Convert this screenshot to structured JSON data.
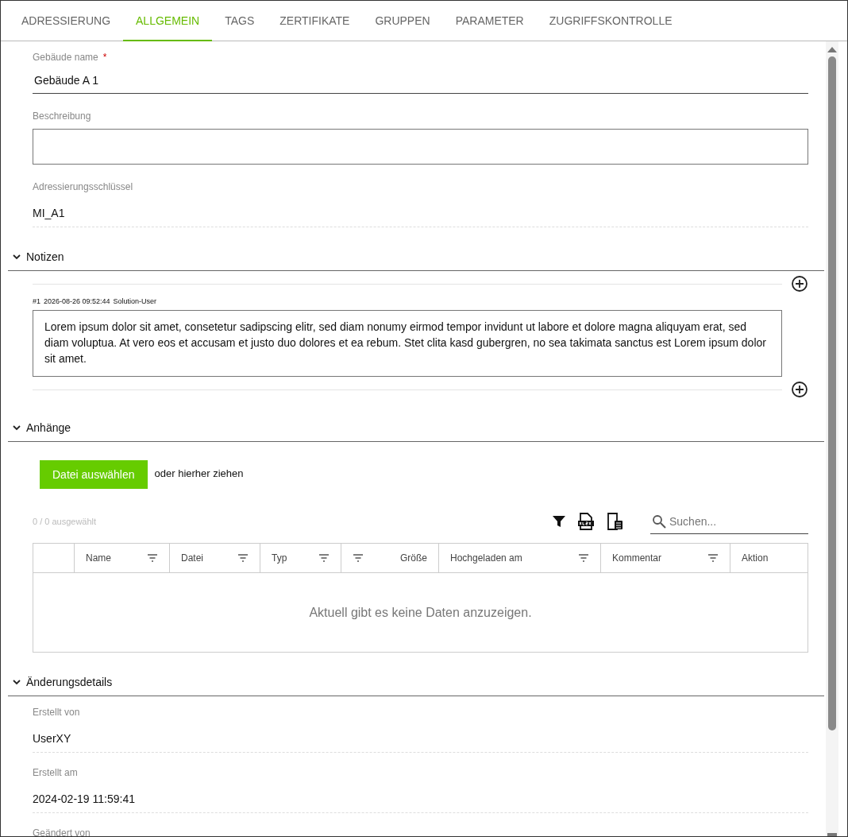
{
  "tabs": [
    {
      "label": "ADRESSIERUNG",
      "selected": false
    },
    {
      "label": "ALLGEMEIN",
      "selected": true
    },
    {
      "label": "TAGS",
      "selected": false
    },
    {
      "label": "ZERTIFIKATE",
      "selected": false
    },
    {
      "label": "GRUPPEN",
      "selected": false
    },
    {
      "label": "PARAMETER",
      "selected": false
    },
    {
      "label": "ZUGRIFFSKONTROLLE",
      "selected": false
    }
  ],
  "general_fields": [
    {
      "kind": "input",
      "label": "Gebäude name",
      "required_mark": "*",
      "value": "Gebäude A 1"
    },
    {
      "kind": "textarea",
      "label": "Beschreibung"
    },
    {
      "kind": "readonly",
      "label": "Adressierungsschlüssel",
      "value": "MI_A1"
    }
  ],
  "notes_section": {
    "title": "Notizen",
    "expanded": true,
    "notes": [
      {
        "number": "#1",
        "timestamp": "2026-08-26 09:52:44",
        "author": "Solution-User",
        "text": "Lorem ipsum dolor sit amet, consetetur sadipscing elitr, sed diam nonumy eirmod tempor invidunt ut labore et dolore magna aliquyam erat, sed diam voluptua. At vero eos et accusam et justo duo dolores et ea rebum. Stet clita kasd gubergren, no sea takimata sanctus est Lorem ipsum dolor sit amet."
      }
    ]
  },
  "attachments_section": {
    "title": "Anhänge",
    "expanded": true,
    "upload_button": "Datei auswählen",
    "drop_hint": "oder hierher ziehen",
    "selection_count": "0 / 0 ausgewählt",
    "search": {
      "placeholder": "Suchen..."
    },
    "table": {
      "columns": [
        {
          "kind": "select"
        },
        {
          "kind": "text",
          "label": "Name",
          "filterable": true
        },
        {
          "kind": "text",
          "label": "Datei",
          "filterable": true
        },
        {
          "kind": "text",
          "label": "Typ",
          "filterable": true
        },
        {
          "kind": "number",
          "label": "Größe",
          "filterable": true
        },
        {
          "kind": "text",
          "label": "Hochgeladen am",
          "filterable": true
        },
        {
          "kind": "text",
          "label": "Kommentar",
          "filterable": true
        },
        {
          "kind": "text",
          "label": "Aktion",
          "filterable": false
        }
      ],
      "empty_message": "Aktuell gibt es keine Daten anzuzeigen."
    }
  },
  "change_details_section": {
    "title": "Änderungsdetails",
    "expanded": true,
    "fields": [
      {
        "kind": "readonly",
        "label": "Erstellt von",
        "value": "UserXY"
      },
      {
        "kind": "readonly",
        "label": "Erstellt am",
        "value": "2024-02-19 11:59:41"
      },
      {
        "kind": "readonly",
        "label": "Geändert von"
      }
    ]
  }
}
